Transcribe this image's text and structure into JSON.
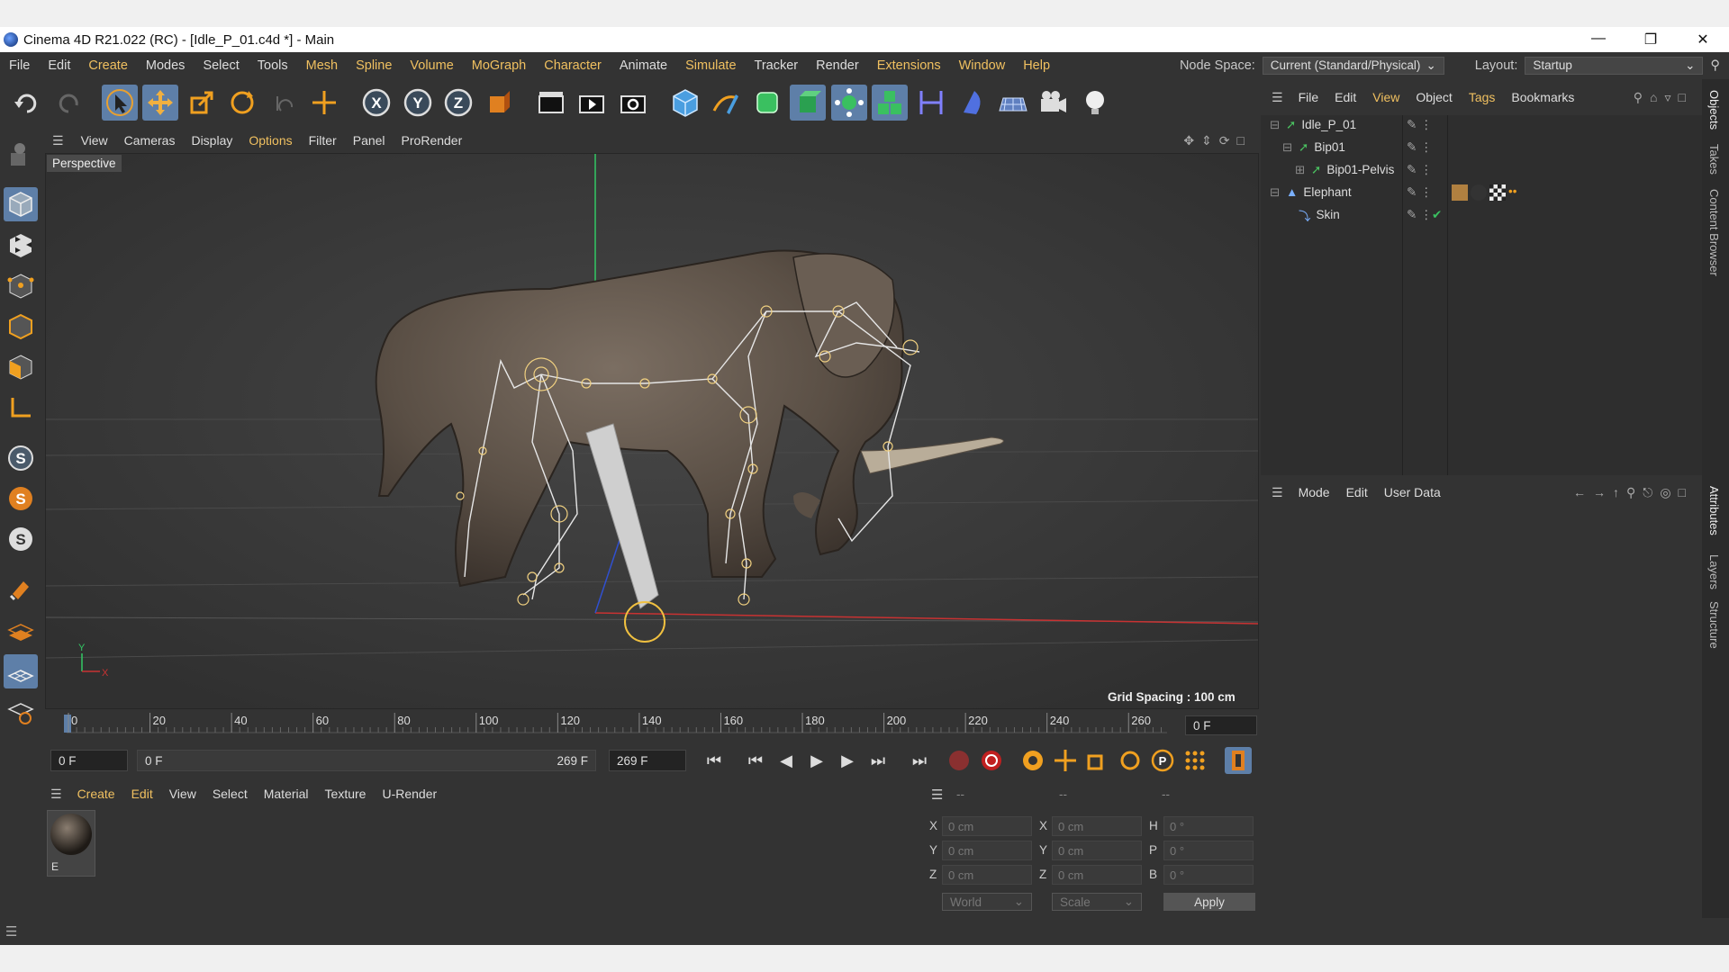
{
  "window": {
    "title": "Cinema 4D R21.022 (RC) - [Idle_P_01.c4d *] - Main",
    "minimize": "—",
    "restore": "❐",
    "close": "✕"
  },
  "menubar": {
    "items": [
      "File",
      "Edit",
      "Create",
      "Modes",
      "Select",
      "Tools",
      "Mesh",
      "Spline",
      "Volume",
      "MoGraph",
      "Character",
      "Animate",
      "Simulate",
      "Tracker",
      "Render",
      "Extensions",
      "Window",
      "Help"
    ],
    "node_space_label": "Node Space:",
    "node_space_value": "Current (Standard/Physical)",
    "layout_label": "Layout:",
    "layout_value": "Startup"
  },
  "toolbar": {
    "axis_x": "X",
    "axis_y": "Y",
    "axis_z": "Z"
  },
  "viewport": {
    "menu": [
      "View",
      "Cameras",
      "Display",
      "Options",
      "Filter",
      "Panel",
      "ProRender"
    ],
    "label": "Perspective",
    "grid_spacing": "Grid Spacing : 100 cm",
    "axis_y": "Y",
    "axis_x": "X"
  },
  "timeline": {
    "ticks": [
      "0",
      "20",
      "40",
      "60",
      "80",
      "100",
      "120",
      "140",
      "160",
      "180",
      "200",
      "220",
      "240",
      "260"
    ],
    "current_frame": "0 F",
    "start_field": "0 F",
    "range_start": "0 F",
    "range_end": "269 F",
    "end_field": "269 F"
  },
  "material_manager": {
    "menu": [
      "Create",
      "Edit",
      "View",
      "Select",
      "Material",
      "Texture",
      "U-Render"
    ],
    "materials": [
      {
        "name": "E"
      }
    ]
  },
  "coordinates": {
    "header": [
      "--",
      "--",
      "--"
    ],
    "rows": [
      {
        "l1": "X",
        "v1": "0 cm",
        "l2": "X",
        "v2": "0 cm",
        "l3": "H",
        "v3": "0 °"
      },
      {
        "l1": "Y",
        "v1": "0 cm",
        "l2": "Y",
        "v2": "0 cm",
        "l3": "P",
        "v3": "0 °"
      },
      {
        "l1": "Z",
        "v1": "0 cm",
        "l2": "Z",
        "v2": "0 cm",
        "l3": "B",
        "v3": "0 °"
      }
    ],
    "world": "World",
    "scale": "Scale",
    "apply": "Apply"
  },
  "objects": {
    "menu": [
      "File",
      "Edit",
      "View",
      "Object",
      "Tags",
      "Bookmarks"
    ],
    "items": [
      {
        "name": "Idle_P_01",
        "depth": 0
      },
      {
        "name": "Bip01",
        "depth": 1
      },
      {
        "name": "Bip01-Pelvis",
        "depth": 2
      },
      {
        "name": "Elephant",
        "depth": 0
      },
      {
        "name": "Skin",
        "depth": 1
      }
    ]
  },
  "attributes": {
    "menu": [
      "Mode",
      "Edit",
      "User Data"
    ]
  },
  "side_tabs": [
    "Objects",
    "Takes",
    "Content Browser",
    "Attributes",
    "Layers",
    "Structure"
  ],
  "colors": {
    "accent": "#f0c060",
    "active_tool": "#5e7fa8",
    "x_axis": "#c83232",
    "y_axis": "#32c864"
  }
}
